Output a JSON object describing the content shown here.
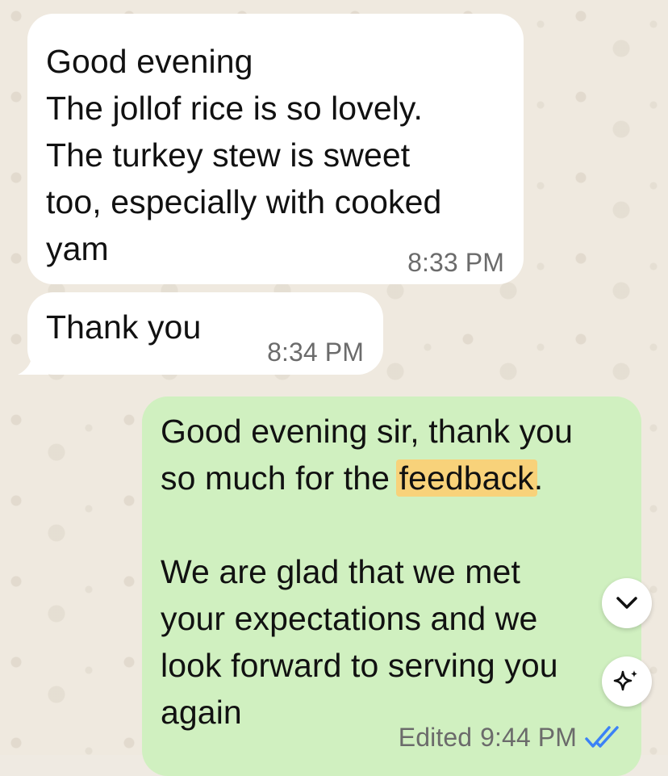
{
  "messages": [
    {
      "direction": "incoming",
      "text": "Good evening\nThe jollof rice is so lovely.\nThe turkey stew is sweet\ntoo, especially with cooked\nyam",
      "time": "8:33 PM"
    },
    {
      "direction": "incoming",
      "text": "Thank you",
      "time": "8:34 PM"
    },
    {
      "direction": "outgoing",
      "text_before": "Good evening sir, thank you\nso much for the ",
      "highlighted_word": "feedback",
      "text_after": ".\n\nWe are glad that we met\nyour expectations and we\nlook forward to serving you\nagain",
      "edited_label": "Edited",
      "time": "9:44 PM",
      "status_icon": "double-check-read-icon"
    }
  ],
  "controls": {
    "scroll_down_icon": "chevron-down-icon",
    "ai_icon": "sparkle-icon"
  },
  "colors": {
    "incoming_bubble": "#ffffff",
    "outgoing_bubble": "#d0f0c0",
    "highlight": "#f8d27a",
    "read_ticks": "#3b82f6",
    "timestamp": "#6b6b6b"
  }
}
